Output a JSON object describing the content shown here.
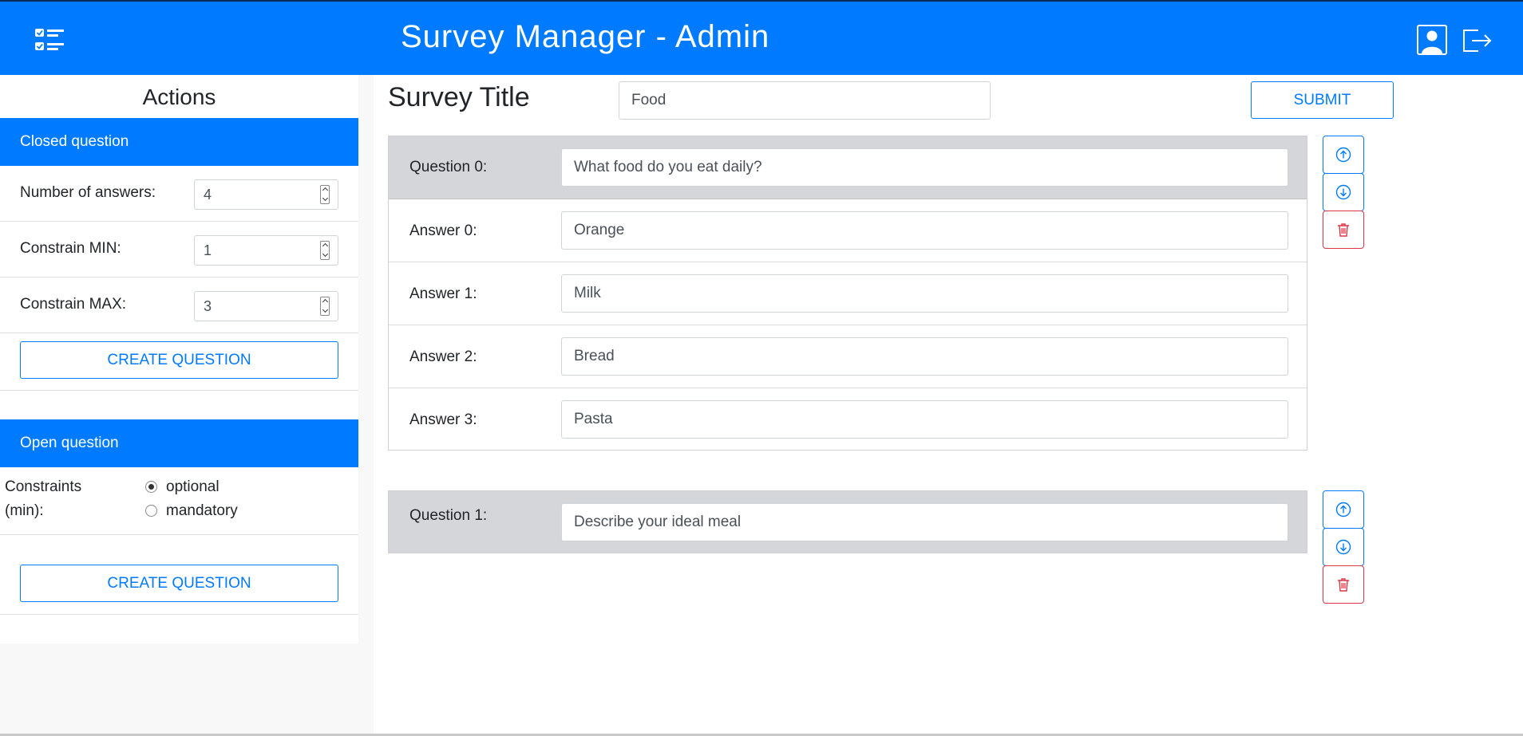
{
  "header": {
    "title": "Survey Manager - Admin",
    "logo_icon": "checklist-icon",
    "user_icon": "user-icon",
    "logout_icon": "logout-icon",
    "bg_color": "#007bff"
  },
  "sidebar": {
    "title": "Actions",
    "closed": {
      "heading": "Closed question",
      "fields": [
        {
          "label": "Number of answers:",
          "value": "4"
        },
        {
          "label": "Constrain MIN:",
          "value": "1"
        },
        {
          "label": "Constrain MAX:",
          "value": "3"
        }
      ],
      "create_label": "CREATE QUESTION"
    },
    "open": {
      "heading": "Open question",
      "constraints_label_1": "Constraints",
      "constraints_label_2": "(min):",
      "options": [
        {
          "label": "optional",
          "selected": true
        },
        {
          "label": "mandatory",
          "selected": false
        }
      ],
      "create_label": "CREATE QUESTION"
    }
  },
  "main": {
    "survey_title_label": "Survey Title",
    "survey_title_value": "Food",
    "submit_label": "SUBMIT",
    "questions": [
      {
        "label": "Question 0:",
        "value": "What food do you eat daily?",
        "answers": [
          {
            "label": "Answer 0:",
            "value": "Orange"
          },
          {
            "label": "Answer 1:",
            "value": "Milk"
          },
          {
            "label": "Answer 2:",
            "value": "Bread"
          },
          {
            "label": "Answer 3:",
            "value": "Pasta"
          }
        ]
      },
      {
        "label": "Question 1:",
        "value": "Describe your ideal meal",
        "answers": []
      }
    ],
    "move_up_icon": "arrow-up-circle-icon",
    "move_down_icon": "arrow-down-circle-icon",
    "delete_icon": "trash-icon",
    "accent_color": "#007bff",
    "danger_color": "#dc3545"
  }
}
